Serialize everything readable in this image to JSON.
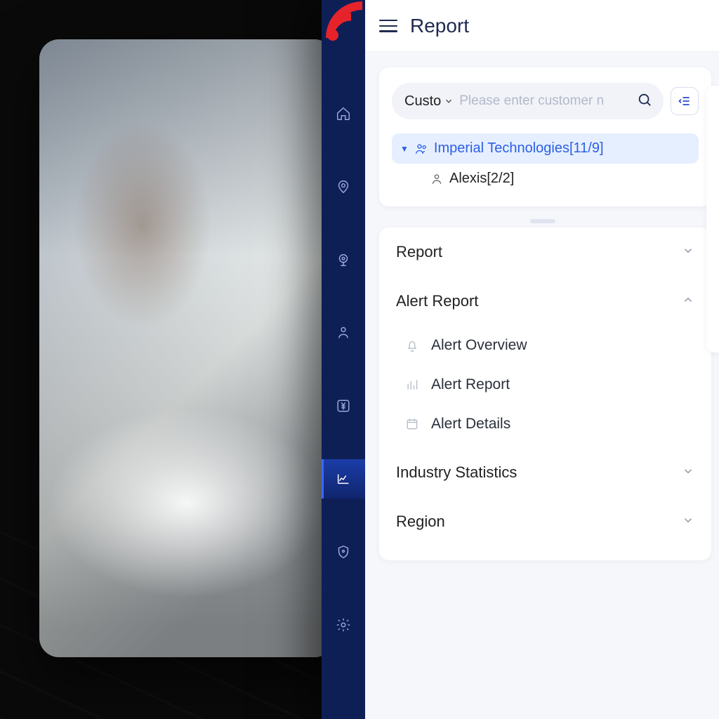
{
  "header": {
    "title": "Report"
  },
  "search": {
    "dropdown_label": "Custo",
    "placeholder": "Please enter customer n"
  },
  "tree": {
    "root": {
      "label": "Imperial Technologies",
      "count": "[11/9]"
    },
    "child": {
      "label": "Alexis",
      "count": "[2/2]"
    }
  },
  "accordion": {
    "report": "Report",
    "alert_report": "Alert Report",
    "alert_overview": "Alert Overview",
    "alert_report_item": "Alert Report",
    "alert_details": "Alert Details",
    "industry_stats": "Industry Statistics",
    "region": "Region"
  }
}
